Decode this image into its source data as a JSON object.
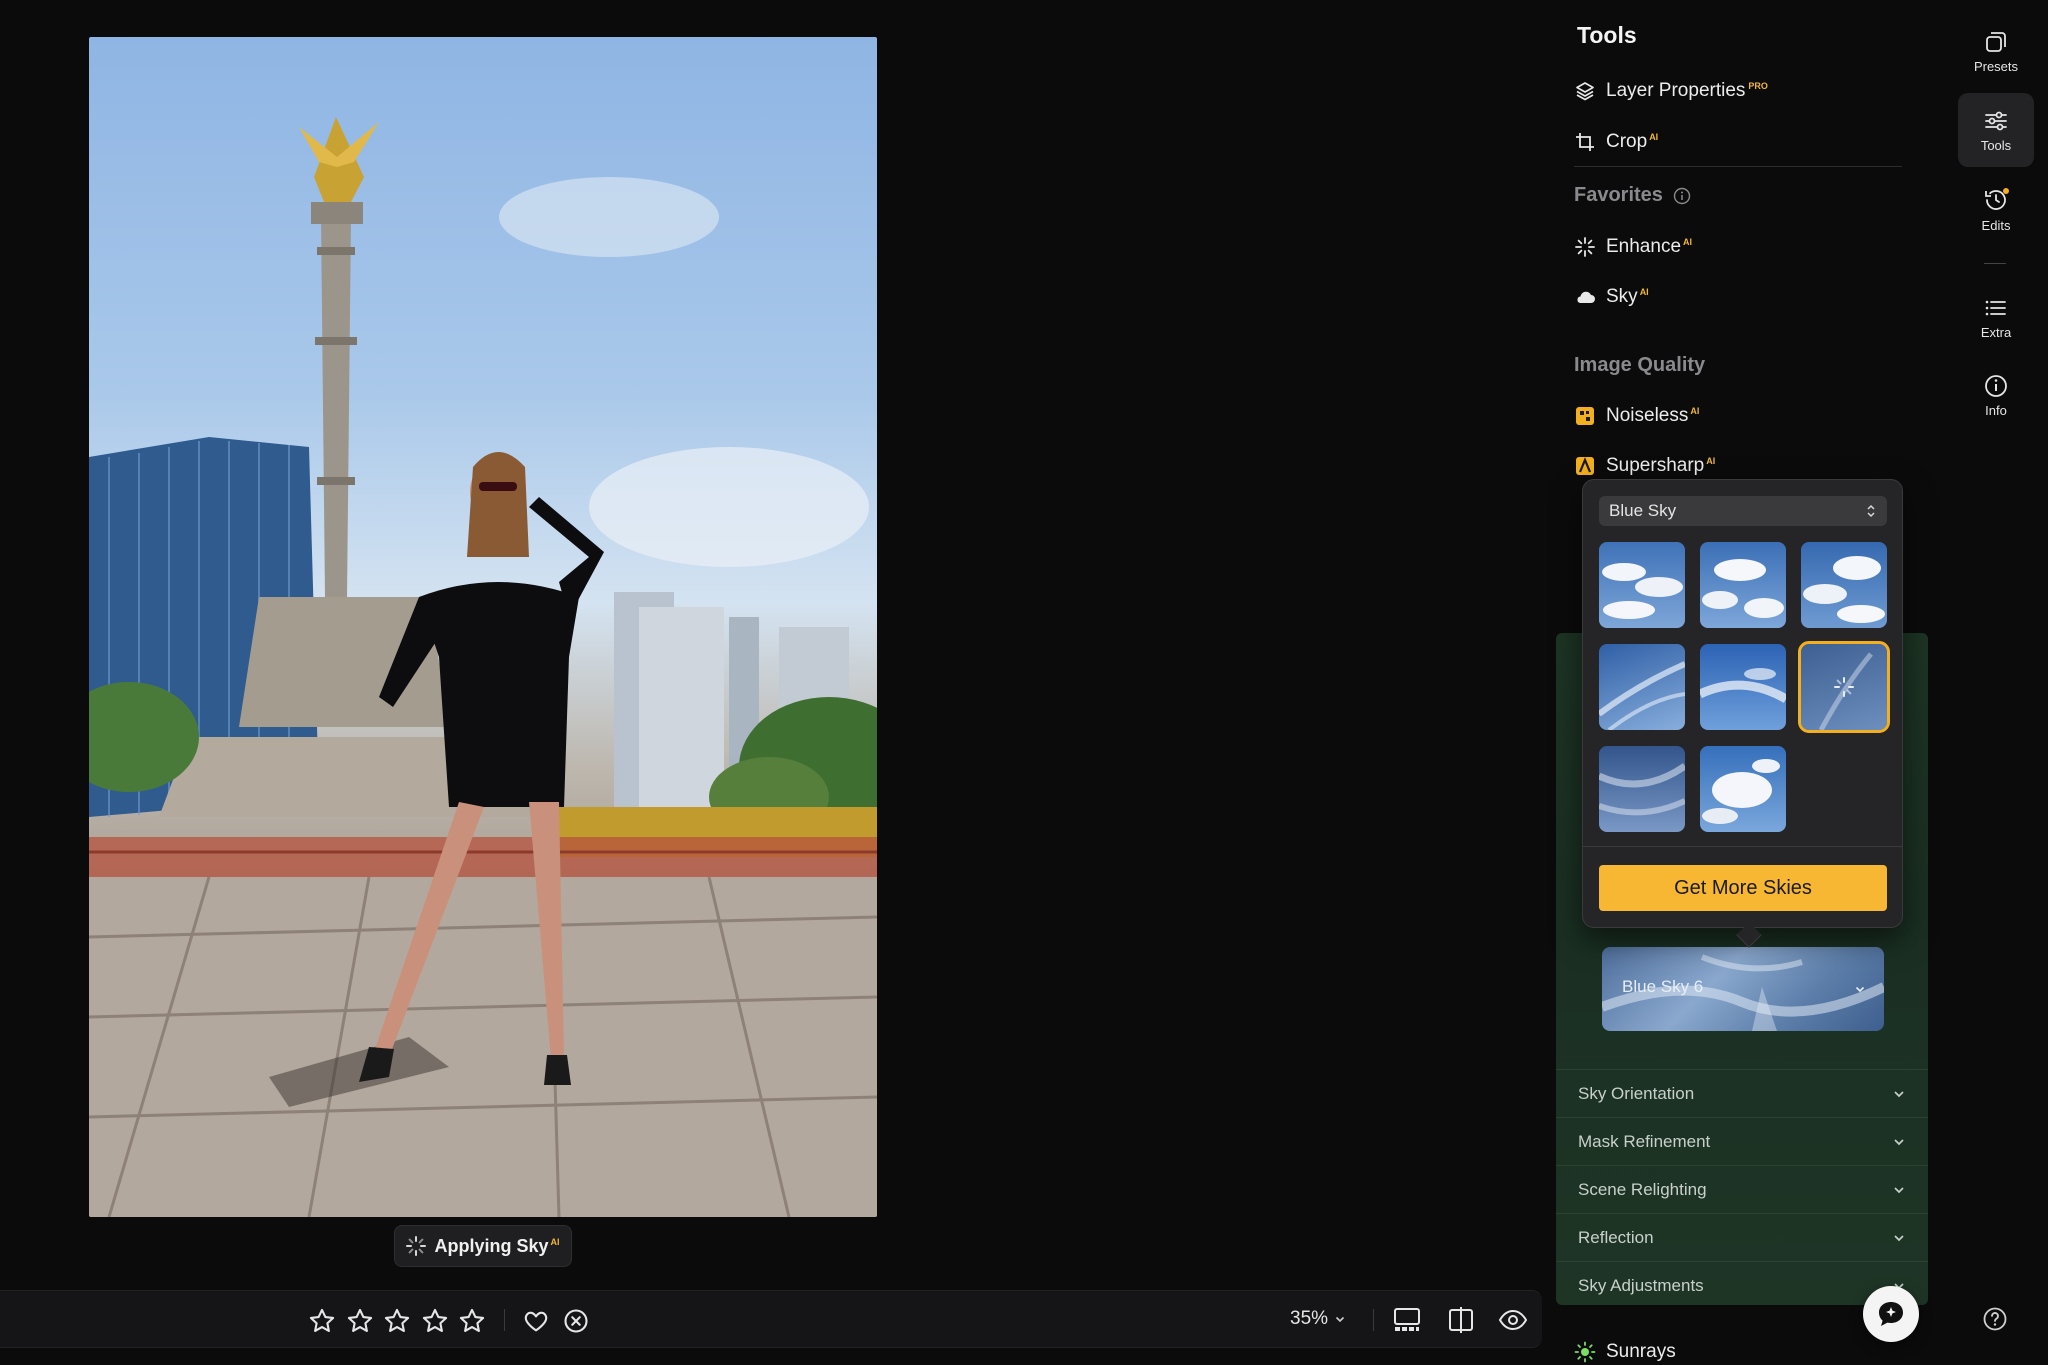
{
  "canvas": {
    "status_label": "Applying Sky",
    "status_ai_badge": "AI"
  },
  "bottom_bar": {
    "rating_stars": 0,
    "rating_max": 5,
    "zoom_label": "35%"
  },
  "tools_panel": {
    "title": "Tools",
    "layer_properties": {
      "label": "Layer Properties",
      "badge": "PRO"
    },
    "crop": {
      "label": "Crop",
      "badge": "AI"
    },
    "favorites_title": "Favorites",
    "enhance": {
      "label": "Enhance",
      "badge": "AI"
    },
    "sky": {
      "label": "Sky",
      "badge": "AI"
    },
    "image_quality_title": "Image Quality",
    "noiseless": {
      "label": "Noiseless",
      "badge": "AI"
    },
    "supersharp": {
      "label": "Supersharp",
      "badge": "AI"
    },
    "sunrays": {
      "label": "Sunrays"
    }
  },
  "sky_card": {
    "selected_sky": "Blue Sky 6",
    "sections": [
      "Sky Orientation",
      "Mask Refinement",
      "Scene Relighting",
      "Reflection",
      "Sky Adjustments"
    ]
  },
  "sky_popover": {
    "category": "Blue Sky",
    "thumbnail_count": 8,
    "selected_index": 5,
    "get_more_label": "Get More Skies"
  },
  "right_rail": {
    "items": [
      {
        "label": "Presets",
        "icon": "presets-icon"
      },
      {
        "label": "Tools",
        "icon": "sliders-icon"
      },
      {
        "label": "Edits",
        "icon": "history-icon"
      },
      {
        "label": "Extra",
        "icon": "list-icon"
      },
      {
        "label": "Info",
        "icon": "info-icon"
      }
    ],
    "active": "Tools",
    "accent_color": "#f2b020"
  }
}
